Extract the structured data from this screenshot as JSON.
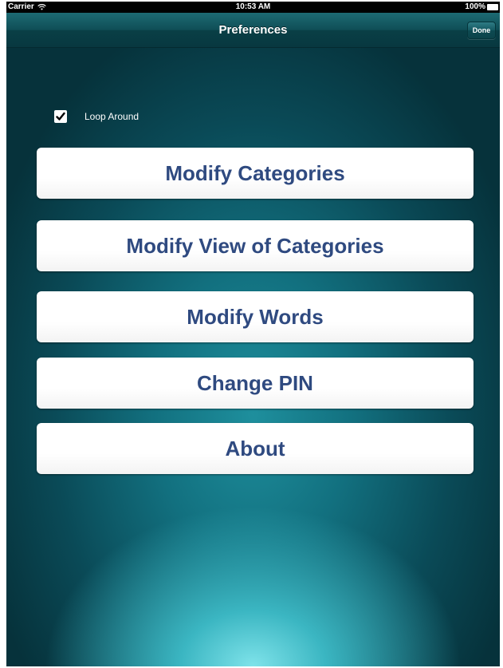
{
  "status_bar": {
    "carrier": "Carrier",
    "time": "10:53 AM",
    "battery": "100%"
  },
  "nav_bar": {
    "title": "Preferences",
    "done_label": "Done"
  },
  "loop_around": {
    "label": "Loop Around",
    "checked": true
  },
  "menu": [
    {
      "label": "Modify Categories"
    },
    {
      "label": "Modify View of Categories"
    },
    {
      "label": "Modify Words"
    },
    {
      "label": "Change PIN"
    },
    {
      "label": "About"
    }
  ],
  "colors": {
    "button_text": "#2f4a80",
    "nav_bar": "#0f4e56",
    "background": "#12707f"
  },
  "icons": [
    "wifi-icon",
    "battery-icon",
    "checkmark-icon"
  ]
}
